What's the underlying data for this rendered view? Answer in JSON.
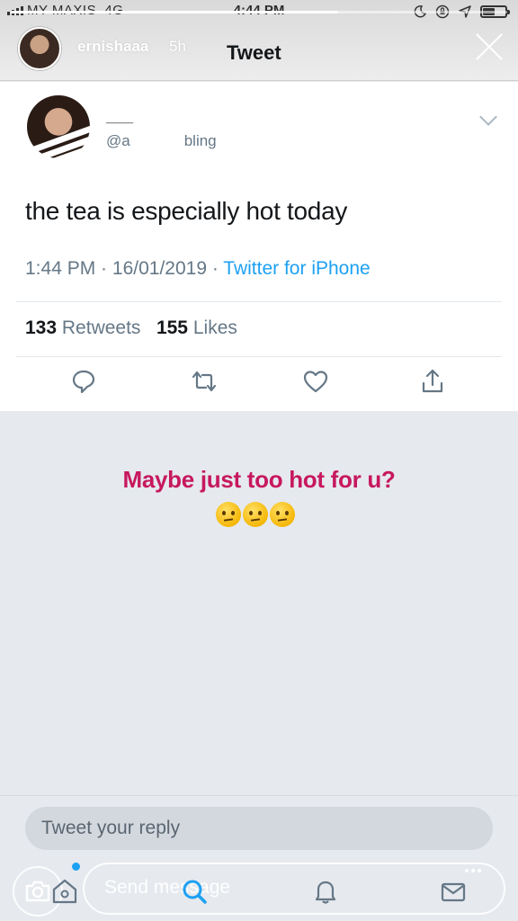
{
  "status_bar": {
    "carrier": "MY MAXIS",
    "network": "4G",
    "time": "4:44 PM"
  },
  "story": {
    "username": "ernishaaa",
    "age": "5h",
    "progress": 0.66,
    "overlay_text": "Maybe just too hot for u?",
    "overlay_color": "#c7185e",
    "emoji_count": 3
  },
  "header": {
    "title": "Tweet"
  },
  "tweet": {
    "name": "___",
    "handle": "@a",
    "handle_tail": "bling",
    "text": "the tea is especially hot today",
    "time": "1:44 PM",
    "date": "16/01/2019",
    "source": "Twitter for iPhone",
    "retweets_count": "133",
    "retweets_label": "Retweets",
    "likes_count": "155",
    "likes_label": "Likes"
  },
  "reply": {
    "placeholder": "Tweet your reply"
  },
  "story_reply": {
    "placeholder": "Send message"
  },
  "colors": {
    "twitter_blue": "#1da1f2",
    "text_dark": "#14171a",
    "text_muted": "#657786"
  }
}
